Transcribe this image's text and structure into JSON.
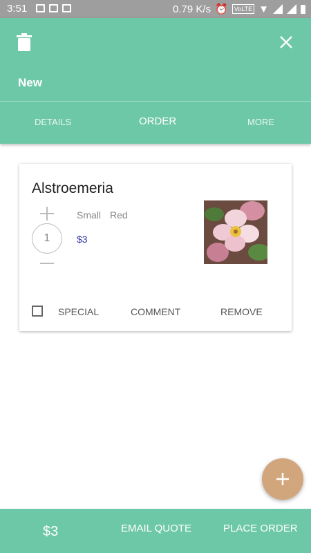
{
  "status_bar": {
    "time": "3:51",
    "speed": "0.79 K/s",
    "network": "VoLTE"
  },
  "header": {
    "title": "New",
    "tabs": [
      {
        "label": "DETAILS",
        "active": false
      },
      {
        "label": "ORDER",
        "active": true
      },
      {
        "label": "MORE",
        "active": false
      }
    ],
    "icons": {
      "left": "trash-icon",
      "right": "close-icon"
    }
  },
  "order_item": {
    "name": "Alstroemeria",
    "quantity": "1",
    "size": "Small",
    "color": "Red",
    "price": "$3",
    "special_checked": false,
    "actions": {
      "special": "SPECIAL",
      "comment": "COMMENT",
      "remove": "REMOVE"
    }
  },
  "fab": {
    "icon": "plus-icon"
  },
  "bottom_bar": {
    "total": "$3",
    "email_quote": "EMAIL QUOTE",
    "place_order": "PLACE ORDER"
  },
  "colors": {
    "primary": "#6dc8a8",
    "fab": "#d2a67c",
    "price_text": "#3333aa"
  }
}
